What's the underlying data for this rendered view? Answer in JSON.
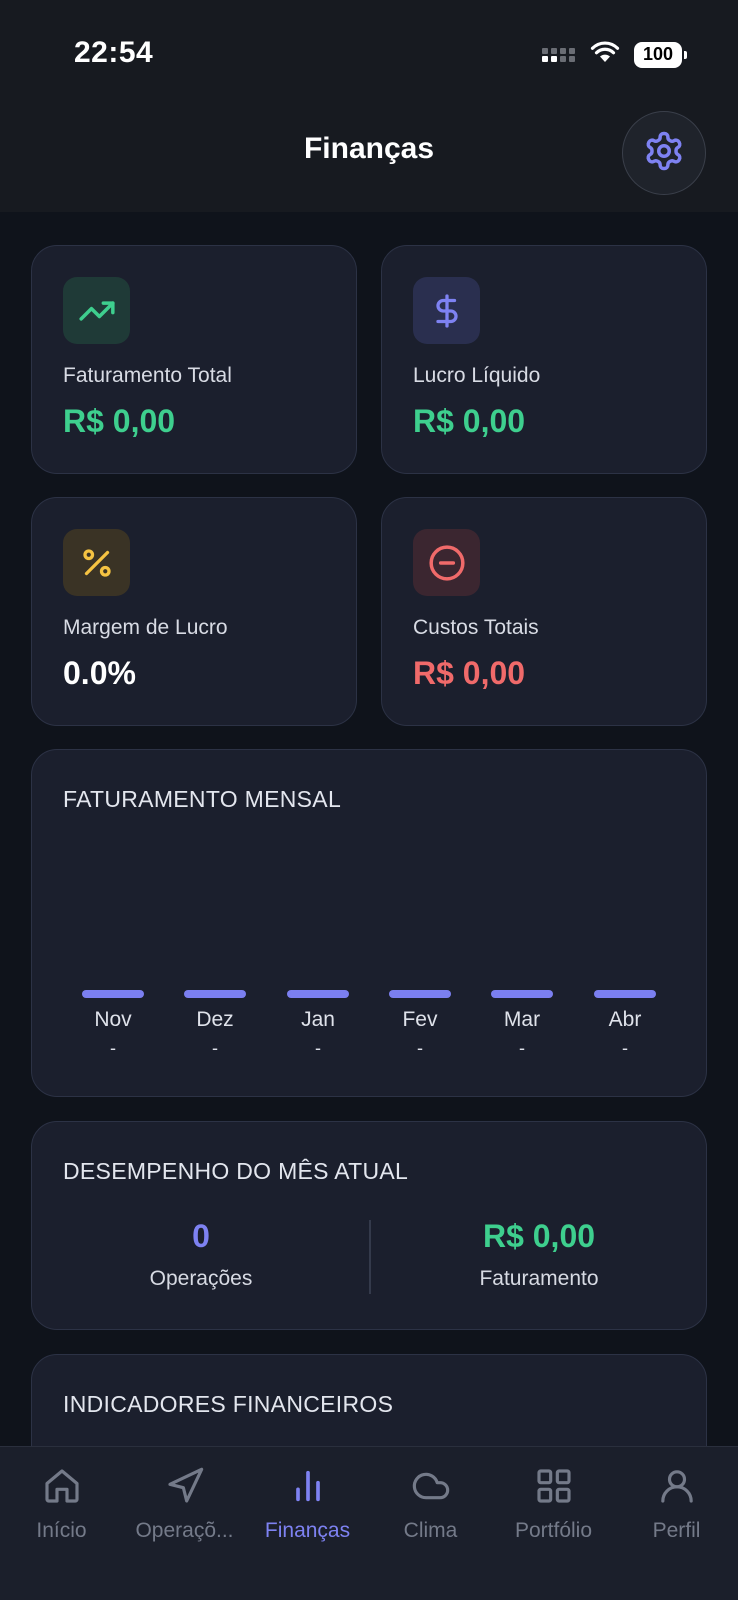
{
  "status_bar": {
    "time": "22:54",
    "battery": "100"
  },
  "header": {
    "title": "Finanças"
  },
  "stats": [
    {
      "label": "Faturamento Total",
      "value": "R$ 0,00",
      "icon": "trending-up-icon",
      "color": "#3ecf8e"
    },
    {
      "label": "Lucro Líquido",
      "value": "R$ 0,00",
      "icon": "dollar-icon",
      "color": "#3ecf8e"
    },
    {
      "label": "Margem de Lucro",
      "value": "0.0%",
      "icon": "percent-icon",
      "color": "#ffffff"
    },
    {
      "label": "Custos Totais",
      "value": "R$ 0,00",
      "icon": "minus-circle-icon",
      "color": "#f06a6a"
    }
  ],
  "monthly": {
    "title": "FATURAMENTO MENSAL",
    "months": [
      {
        "label": "Nov",
        "value": "-"
      },
      {
        "label": "Dez",
        "value": "-"
      },
      {
        "label": "Jan",
        "value": "-"
      },
      {
        "label": "Fev",
        "value": "-"
      },
      {
        "label": "Mar",
        "value": "-"
      },
      {
        "label": "Abr",
        "value": "-"
      }
    ]
  },
  "performance": {
    "title": "DESEMPENHO DO MÊS ATUAL",
    "operations_value": "0",
    "operations_label": "Operações",
    "revenue_value": "R$ 0,00",
    "revenue_label": "Faturamento"
  },
  "indicators": {
    "title": "INDICADORES FINANCEIROS"
  },
  "nav": [
    {
      "label": "Início",
      "icon": "home-icon"
    },
    {
      "label": "Operaçõ...",
      "icon": "navigation-icon"
    },
    {
      "label": "Finanças",
      "icon": "bar-chart-icon"
    },
    {
      "label": "Clima",
      "icon": "cloud-icon"
    },
    {
      "label": "Portfólio",
      "icon": "grid-icon"
    },
    {
      "label": "Perfil",
      "icon": "user-icon"
    }
  ],
  "colors": {
    "accent": "#7e82f2",
    "positive": "#3ecf8e",
    "negative": "#f06a6a",
    "warning": "#f5c342"
  }
}
